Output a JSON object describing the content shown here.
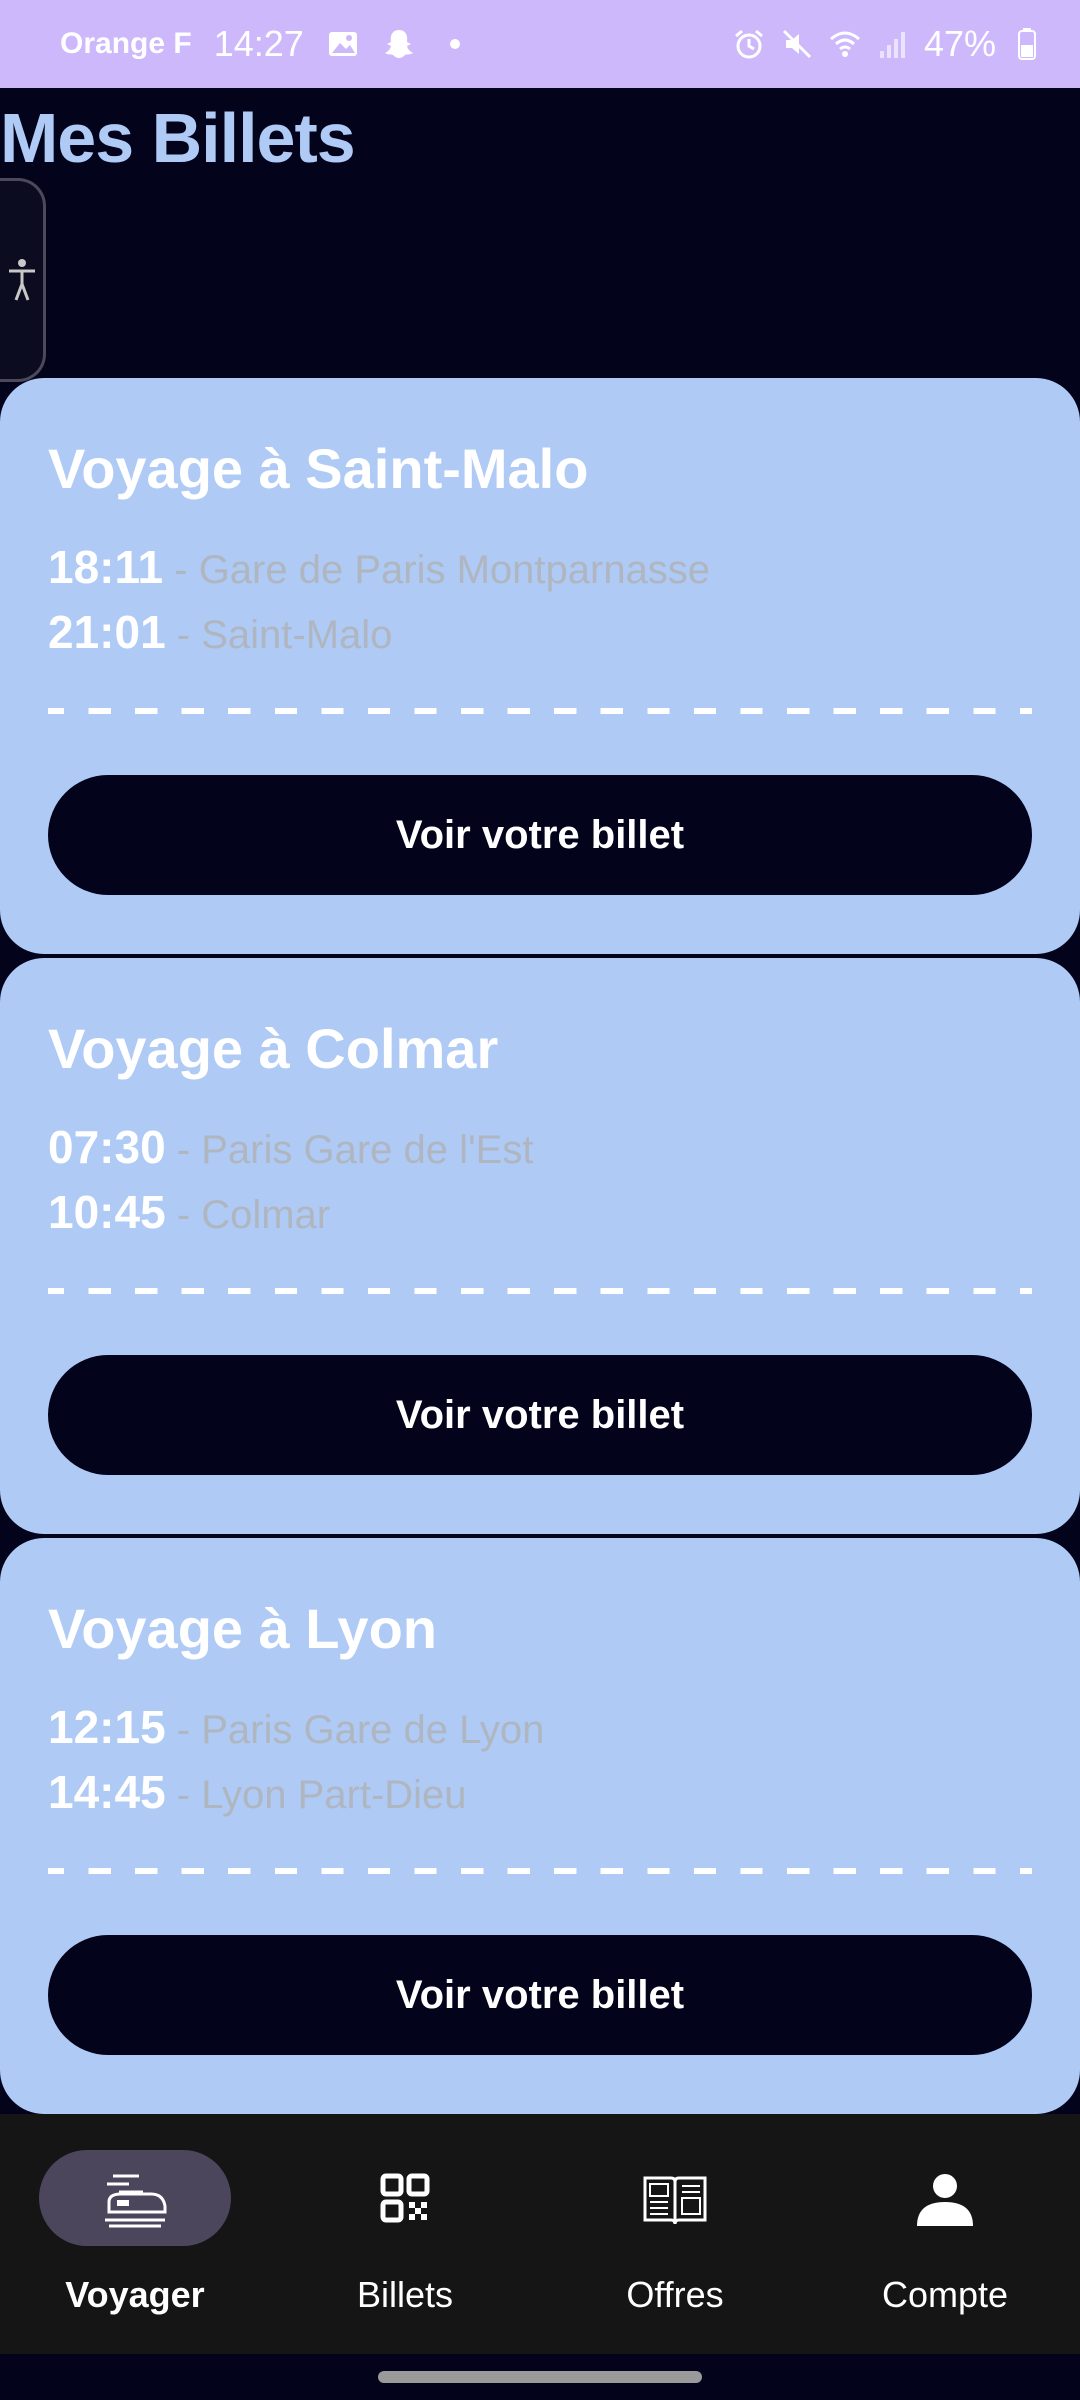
{
  "status_bar": {
    "carrier": "Orange F",
    "time": "14:27",
    "battery": "47%"
  },
  "page": {
    "title": "Mes Billets"
  },
  "tickets": [
    {
      "title": "Voyage à Saint-Malo",
      "departure_time": "18:11",
      "departure_station": "Gare de Paris Montparnasse",
      "arrival_time": "21:01",
      "arrival_station": "Saint-Malo",
      "button_label": "Voir votre billet"
    },
    {
      "title": "Voyage à Colmar",
      "departure_time": "07:30",
      "departure_station": "Paris Gare de l'Est",
      "arrival_time": "10:45",
      "arrival_station": "Colmar",
      "button_label": "Voir votre billet"
    },
    {
      "title": "Voyage à Lyon",
      "departure_time": "12:15",
      "departure_station": "Paris Gare de Lyon",
      "arrival_time": "14:45",
      "arrival_station": "Lyon Part-Dieu",
      "button_label": "Voir votre billet"
    }
  ],
  "separator": "-",
  "bottom_nav": {
    "items": [
      {
        "label": "Voyager",
        "icon": "train-icon",
        "active": true
      },
      {
        "label": "Billets",
        "icon": "qr-code-icon",
        "active": false
      },
      {
        "label": "Offres",
        "icon": "magazine-icon",
        "active": false
      },
      {
        "label": "Compte",
        "icon": "person-icon",
        "active": false
      }
    ]
  },
  "colors": {
    "background": "#03031c",
    "card": "#aecaf5",
    "status_bar": "#cdb8fb",
    "nav_bar": "#151515",
    "nav_active": "#4b465c"
  }
}
